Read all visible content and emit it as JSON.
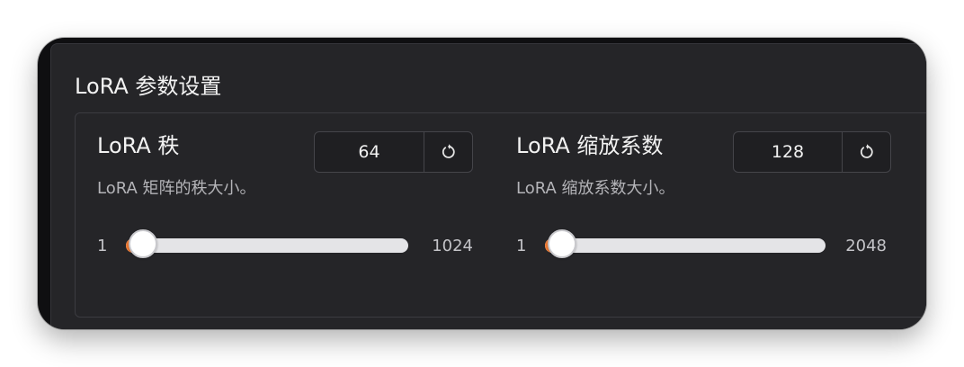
{
  "panel": {
    "title": "LoRA 参数设置"
  },
  "settings": [
    {
      "title": "LoRA 秩",
      "description": "LoRA 矩阵的秩大小。",
      "value": "64",
      "min": "1",
      "max": "1024",
      "slider_fraction": 0.062
    },
    {
      "title": "LoRA 缩放系数",
      "description": "LoRA 缩放系数大小。",
      "value": "128",
      "min": "1",
      "max": "2048",
      "slider_fraction": 0.062
    }
  ],
  "icons": {
    "reset": "reset-icon"
  },
  "colors": {
    "accent": "#ee7a33",
    "panel_bg": "#252528",
    "track": "#e4e4e7"
  }
}
